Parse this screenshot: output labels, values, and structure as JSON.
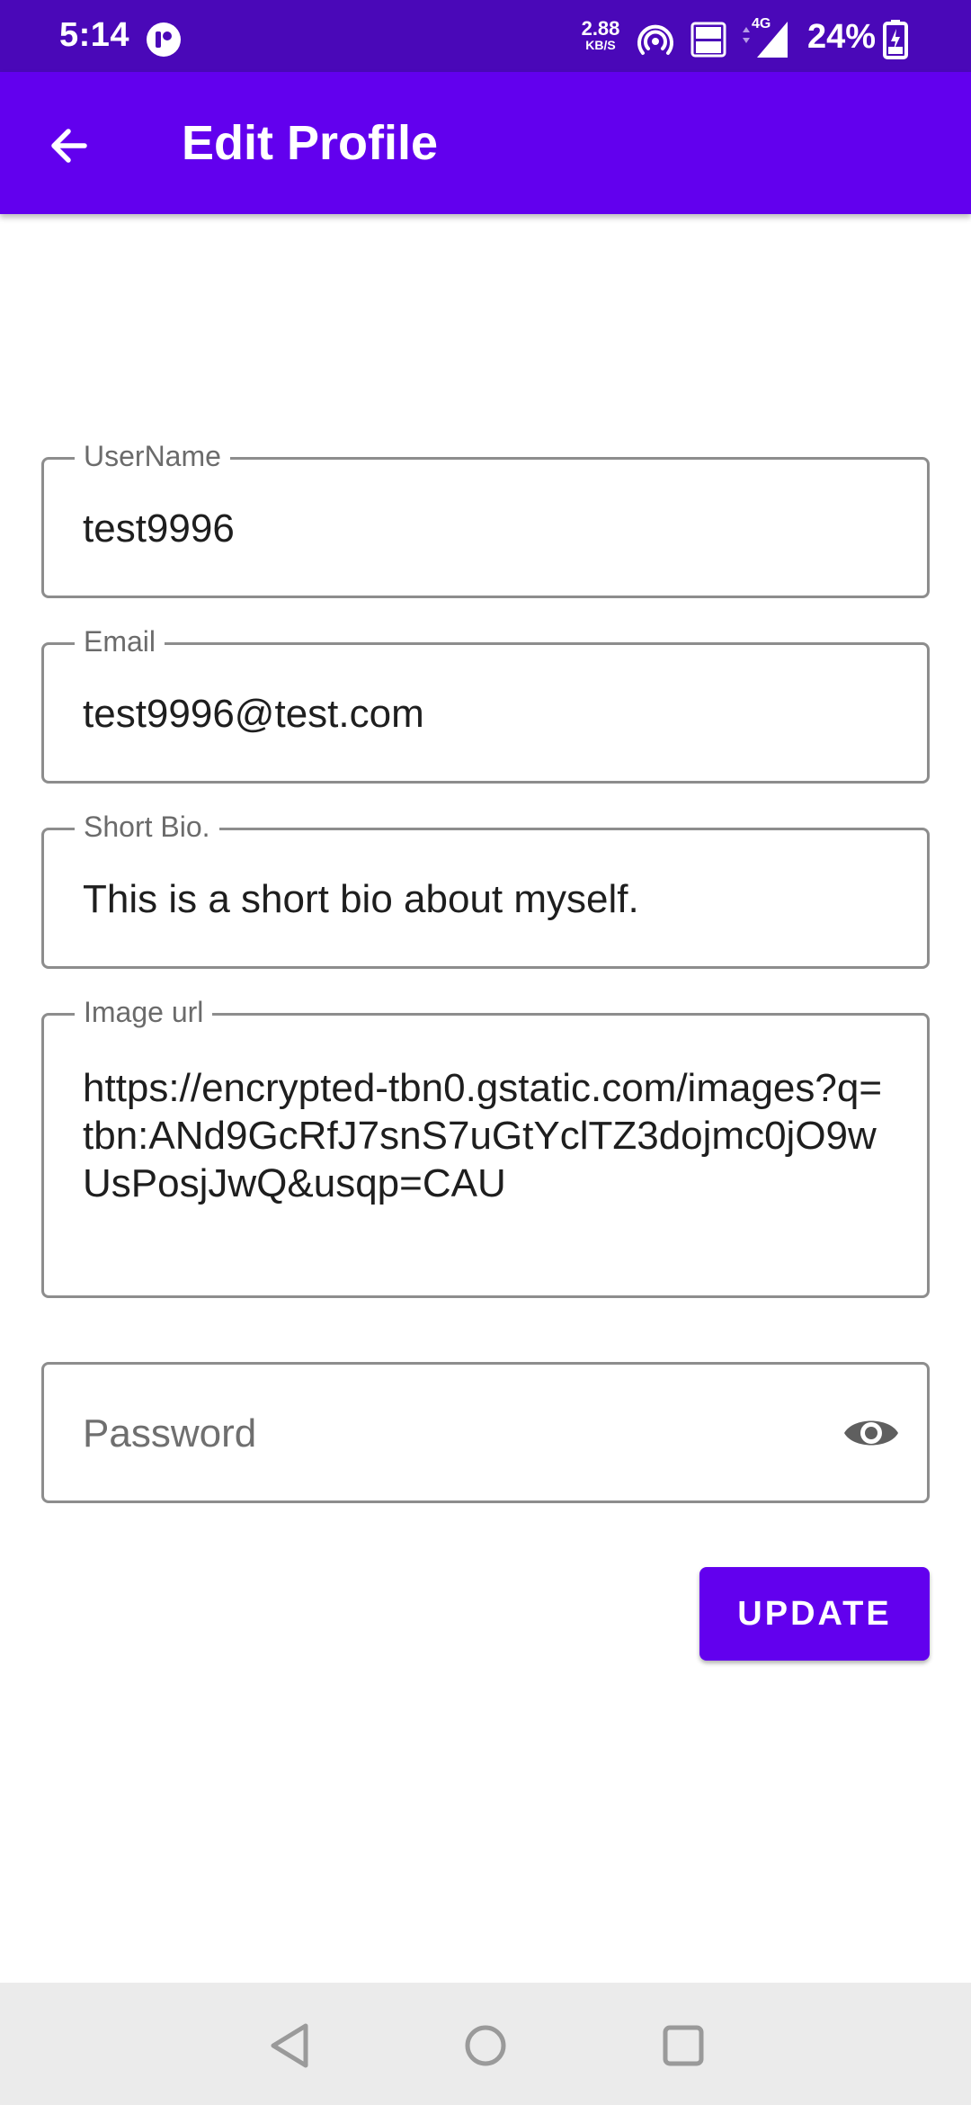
{
  "status_bar": {
    "time": "5:14",
    "net_speed_value": "2.88",
    "net_speed_unit": "KB/S",
    "network_type": "4G",
    "battery_percent": "24%"
  },
  "app_bar": {
    "title": "Edit Profile",
    "back_icon": "arrow-back-icon"
  },
  "form": {
    "username": {
      "label": "UserName",
      "value": "test9996"
    },
    "email": {
      "label": "Email",
      "value": "test9996@test.com"
    },
    "bio": {
      "label": "Short Bio.",
      "value": "This is a short bio about myself."
    },
    "image_url": {
      "label": "Image url",
      "value": "https://encrypted-tbn0.gstatic.com/images?q=tbn:ANd9GcRfJ7snS7uGtYclTZ3dojmc0jO9wUsPosjJwQ&usqp=CAU"
    },
    "password": {
      "placeholder": "Password",
      "toggle_icon": "eye-icon"
    },
    "update_label": "UPDATE"
  },
  "colors": {
    "status_bar": "#4a08b8",
    "primary": "#6200ee",
    "field_border": "#8d8d8d",
    "nav_bar": "#ebebeb"
  }
}
